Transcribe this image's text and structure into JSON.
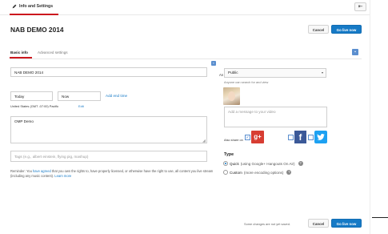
{
  "header": {
    "tab_label": "Info and Settings",
    "back_glyph": "⇤",
    "page_title": "NAB DEMO 2014",
    "cancel_label": "Cancel",
    "go_live_label": "Go live now"
  },
  "tabs": [
    {
      "label": "Basic info"
    },
    {
      "label": "Advanced settings"
    }
  ],
  "form": {
    "title_value": "NAB DEMO 2014",
    "date_value": "Today",
    "time_value": "Now",
    "add_end_time_label": "Add end time",
    "timezone_label": "United States (GMT -07:00) Pacific",
    "timezone_edit_label": "Edit",
    "description_value": "OMP Demo",
    "tags_placeholder": "Tags (e.g., albert einstein, flying pig, mashup)",
    "reminder_prefix": "Reminder: You ",
    "reminder_link1": "have agreed",
    "reminder_middle": " that you own the rights to, have properly licensed, or otherwise have the right to use, all content you live stream (including any music content). ",
    "reminder_link2": "Learn more"
  },
  "privacy": {
    "cropped_label": "An",
    "selected": "Public",
    "hint": "Anyone can search for and view"
  },
  "share": {
    "message_placeholder": "Add a message to your video",
    "also_share_label": "Also share on",
    "gplus_glyph": "g+",
    "facebook_glyph": "f",
    "twitter_glyph": "🐦",
    "check_glyph": "✓"
  },
  "type_section": {
    "heading": "Type",
    "options": [
      {
        "label": "Quick",
        "detail": "(using Google+ Hangouts On Air)",
        "selected": true
      },
      {
        "label": "Custom",
        "detail": "(more encoding options)",
        "selected": false
      }
    ],
    "help_glyph": "?"
  },
  "footer": {
    "status": "Some changes are not yet saved.",
    "cancel_label": "Cancel",
    "go_live_label": "Go live now"
  },
  "colors": {
    "accent_red": "#cc181e",
    "primary_blue": "#167ac6",
    "gplus": "#d73d32",
    "facebook": "#3b5998",
    "twitter": "#1da1f2"
  }
}
